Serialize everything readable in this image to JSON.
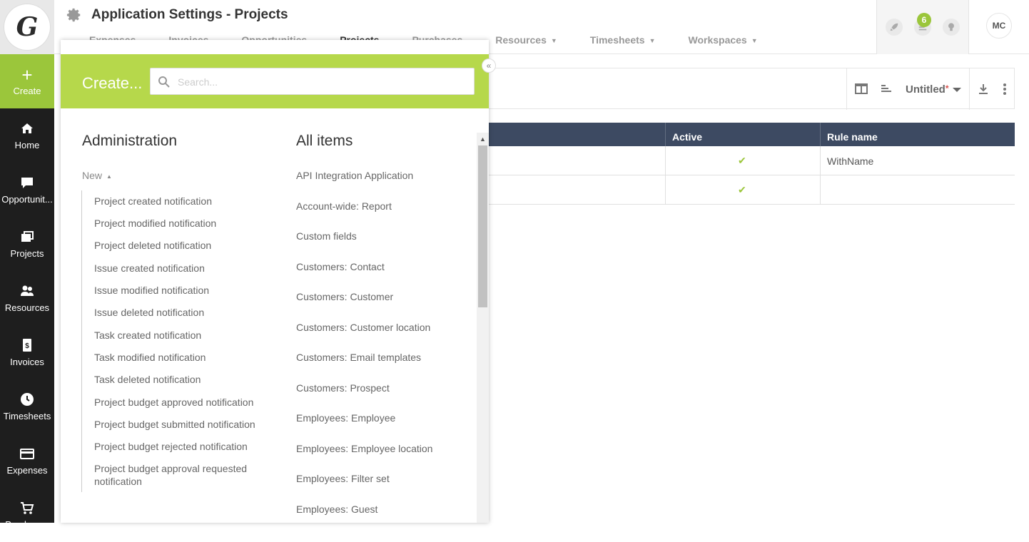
{
  "app": {
    "title": "Application Settings - Projects",
    "logo_letter": "G"
  },
  "sidebar": {
    "create_label": "Create",
    "items": [
      {
        "label": "Home",
        "icon": "home-icon"
      },
      {
        "label": "Opportunit...",
        "icon": "chat-icon"
      },
      {
        "label": "Projects",
        "icon": "projects-icon"
      },
      {
        "label": "Resources",
        "icon": "people-icon"
      },
      {
        "label": "Invoices",
        "icon": "invoice-icon"
      },
      {
        "label": "Timesheets",
        "icon": "clock-icon"
      },
      {
        "label": "Expenses",
        "icon": "card-icon"
      },
      {
        "label": "Purchases",
        "icon": "cart-icon"
      }
    ]
  },
  "header": {
    "tabs": [
      {
        "label": "Expenses",
        "dropdown": false
      },
      {
        "label": "Invoices",
        "dropdown": false
      },
      {
        "label": "Opportunities",
        "dropdown": false
      },
      {
        "label": "Projects",
        "dropdown": false
      },
      {
        "label": "Purchases",
        "dropdown": false
      },
      {
        "label": "Resources",
        "dropdown": true
      },
      {
        "label": "Timesheets",
        "dropdown": true
      },
      {
        "label": "Workspaces",
        "dropdown": true
      }
    ],
    "notification_count": "6",
    "user_initials": "MC"
  },
  "toolbar": {
    "view_name": "Untitled",
    "modified_marker": "*"
  },
  "table": {
    "columns": [
      "Active",
      "Rule name"
    ],
    "rows": [
      {
        "active": "✔",
        "rule_name": "WithName"
      },
      {
        "active": "✔",
        "rule_name": ""
      }
    ]
  },
  "create_panel": {
    "title": "Create...",
    "search_placeholder": "Search...",
    "collapse_glyph": "«",
    "admin_heading": "Administration",
    "new_label": "New",
    "admin_items": [
      "Project created notification",
      "Project modified notification",
      "Project deleted notification",
      "Issue created notification",
      "Issue modified notification",
      "Issue deleted notification",
      "Task created notification",
      "Task modified notification",
      "Task deleted notification",
      "Project budget approved notification",
      "Project budget submitted notification",
      "Project budget rejected notification",
      "Project budget approval requested notification"
    ],
    "all_heading": "All items",
    "all_items": [
      "API Integration Application",
      "Account-wide: Report",
      "Custom fields",
      "Customers: Contact",
      "Customers: Customer",
      "Customers: Customer location",
      "Customers: Email templates",
      "Customers: Prospect",
      "Employees: Employee",
      "Employees: Employee location",
      "Employees: Filter set",
      "Employees: Guest"
    ]
  },
  "colors": {
    "accent": "#9bc63b",
    "panel_header": "#b6d84b",
    "table_header": "#3d4a62",
    "sidebar": "#1e1e1e"
  }
}
